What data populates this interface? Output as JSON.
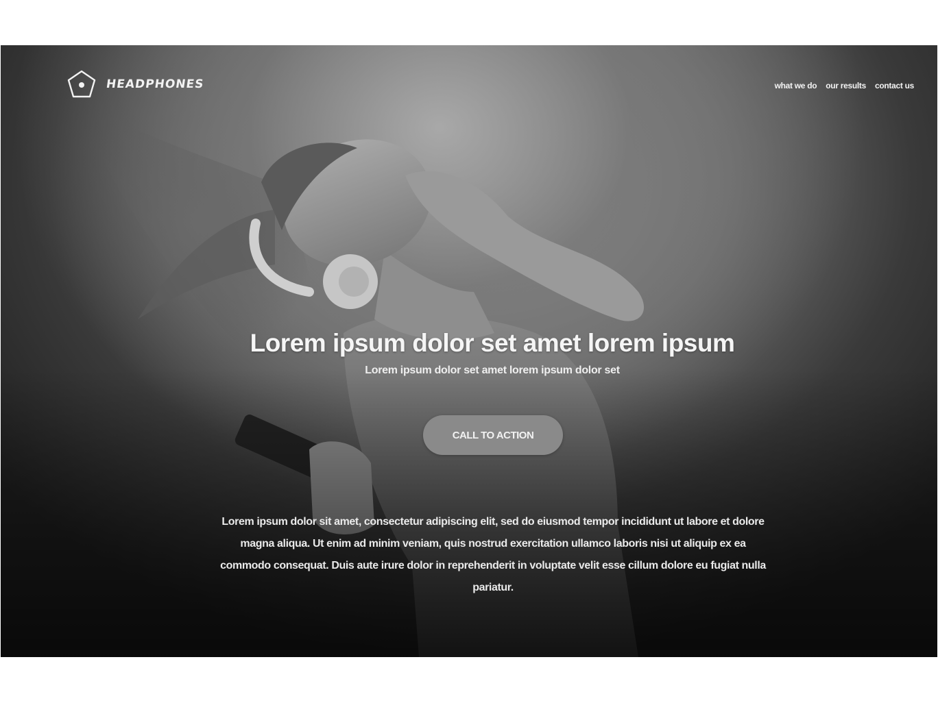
{
  "brand": {
    "name": "HEADPHONES",
    "logo_icon": "pentagon-dot-icon"
  },
  "nav": {
    "items": [
      {
        "label": "what we do"
      },
      {
        "label": "our results"
      },
      {
        "label": "contact us"
      }
    ]
  },
  "hero": {
    "headline": "Lorem ipsum dolor set amet lorem ipsum",
    "subheadline": "Lorem ipsum dolor set amet lorem ipsum dolor set",
    "cta_label": "CALL TO ACTION",
    "body": "Lorem ipsum dolor sit amet, consectetur adipiscing elit, sed do eiusmod tempor incididunt ut labore et dolore magna aliqua. Ut enim ad minim veniam, quis nostrud exercitation ullamco laboris nisi ut aliquip ex ea commodo consequat. Duis aute irure dolor in reprehenderit in voluptate velit esse cillum dolore eu fugiat nulla pariatur."
  },
  "colors": {
    "background": "#ffffff",
    "hero_overlay": "#3a3a3a",
    "cta_background": "#8a8a8a",
    "text": "#f5f5f5"
  }
}
